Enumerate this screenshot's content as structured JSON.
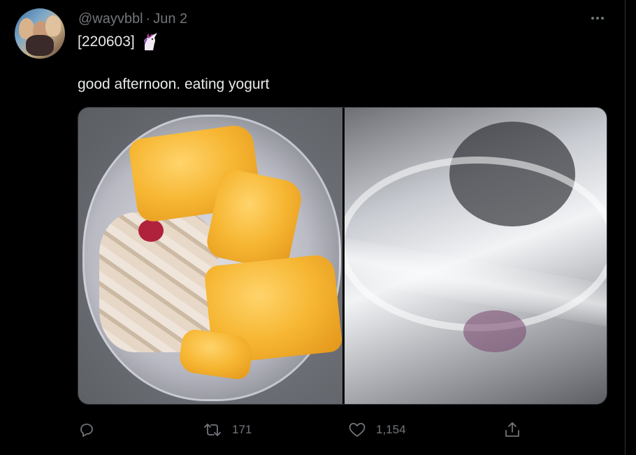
{
  "tweet": {
    "handle": "@wayvbbl",
    "separator": "·",
    "date": "Jun 2",
    "text_line1": "[220603]",
    "emoji_icon": "unicorn-icon",
    "text_line2": "good afternoon. eating yogurt",
    "media": [
      {
        "description": "yogurt-with-mango"
      },
      {
        "description": "empty-yogurt-cup"
      }
    ]
  },
  "actions": {
    "reply_count": "",
    "retweet_count": "171",
    "like_count": "1,154",
    "share_count": ""
  },
  "colors": {
    "background": "#000000",
    "text": "#e7e9ea",
    "secondary": "#71767b",
    "border": "#2f3336"
  }
}
